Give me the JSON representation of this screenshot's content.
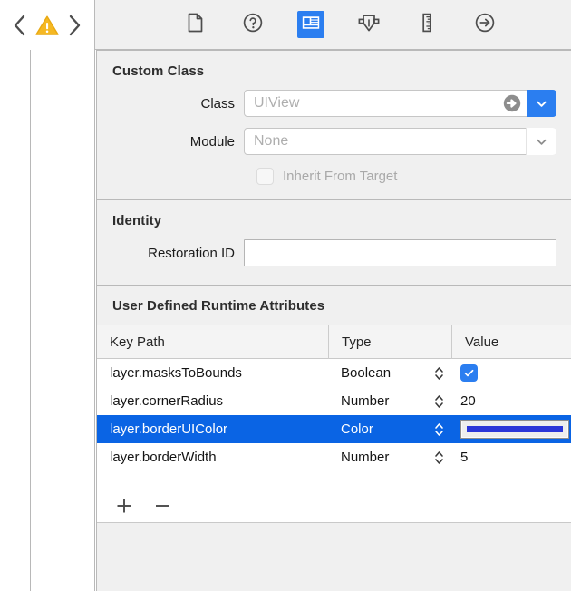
{
  "toolbar": {
    "back_icon": "chevron-left-icon",
    "warning_icon": "warning-triangle-icon",
    "forward_icon": "chevron-right-icon",
    "warning_color": "#f5b823",
    "selected_tab_color": "#2b7ef0",
    "tabs": [
      {
        "name": "file-inspector",
        "icon": "document-icon",
        "selected": false
      },
      {
        "name": "quick-help-inspector",
        "icon": "question-circle-icon",
        "selected": false
      },
      {
        "name": "identity-inspector",
        "icon": "identity-card-icon",
        "selected": true
      },
      {
        "name": "attributes-inspector",
        "icon": "shield-arrow-down-icon",
        "selected": false
      },
      {
        "name": "size-inspector",
        "icon": "ruler-icon",
        "selected": false
      },
      {
        "name": "connections-inspector",
        "icon": "arrow-right-circle-icon",
        "selected": false
      }
    ]
  },
  "custom_class": {
    "title": "Custom Class",
    "class_label": "Class",
    "class_value": "UIView",
    "class_jump_icon": "jump-to-definition-icon",
    "class_chevron_icon": "chevron-down-icon",
    "module_label": "Module",
    "module_value": "None",
    "module_chevron_icon": "chevron-down-icon",
    "inherit_label": "Inherit From Target",
    "inherit_checked": false
  },
  "identity": {
    "title": "Identity",
    "restoration_id_label": "Restoration ID",
    "restoration_id_value": ""
  },
  "runtime_attributes": {
    "title": "User Defined Runtime Attributes",
    "columns": [
      "Key Path",
      "Type",
      "Value"
    ],
    "stepper_icon": "stepper-updown-icon",
    "selection_color": "#0a64e4",
    "rows": [
      {
        "key_path": "layer.masksToBounds",
        "type": "Boolean",
        "value_kind": "checkbox",
        "value": "",
        "checked": true,
        "selected": false
      },
      {
        "key_path": "layer.cornerRadius",
        "type": "Number",
        "value_kind": "text",
        "value": "20",
        "selected": false
      },
      {
        "key_path": "layer.borderUIColor",
        "type": "Color",
        "value_kind": "color",
        "value": "",
        "color": "#2b36d8",
        "selected": true
      },
      {
        "key_path": "layer.borderWidth",
        "type": "Number",
        "value_kind": "text",
        "value": "5",
        "selected": false
      }
    ],
    "add_button_icon": "plus-icon",
    "remove_button_icon": "minus-icon"
  }
}
